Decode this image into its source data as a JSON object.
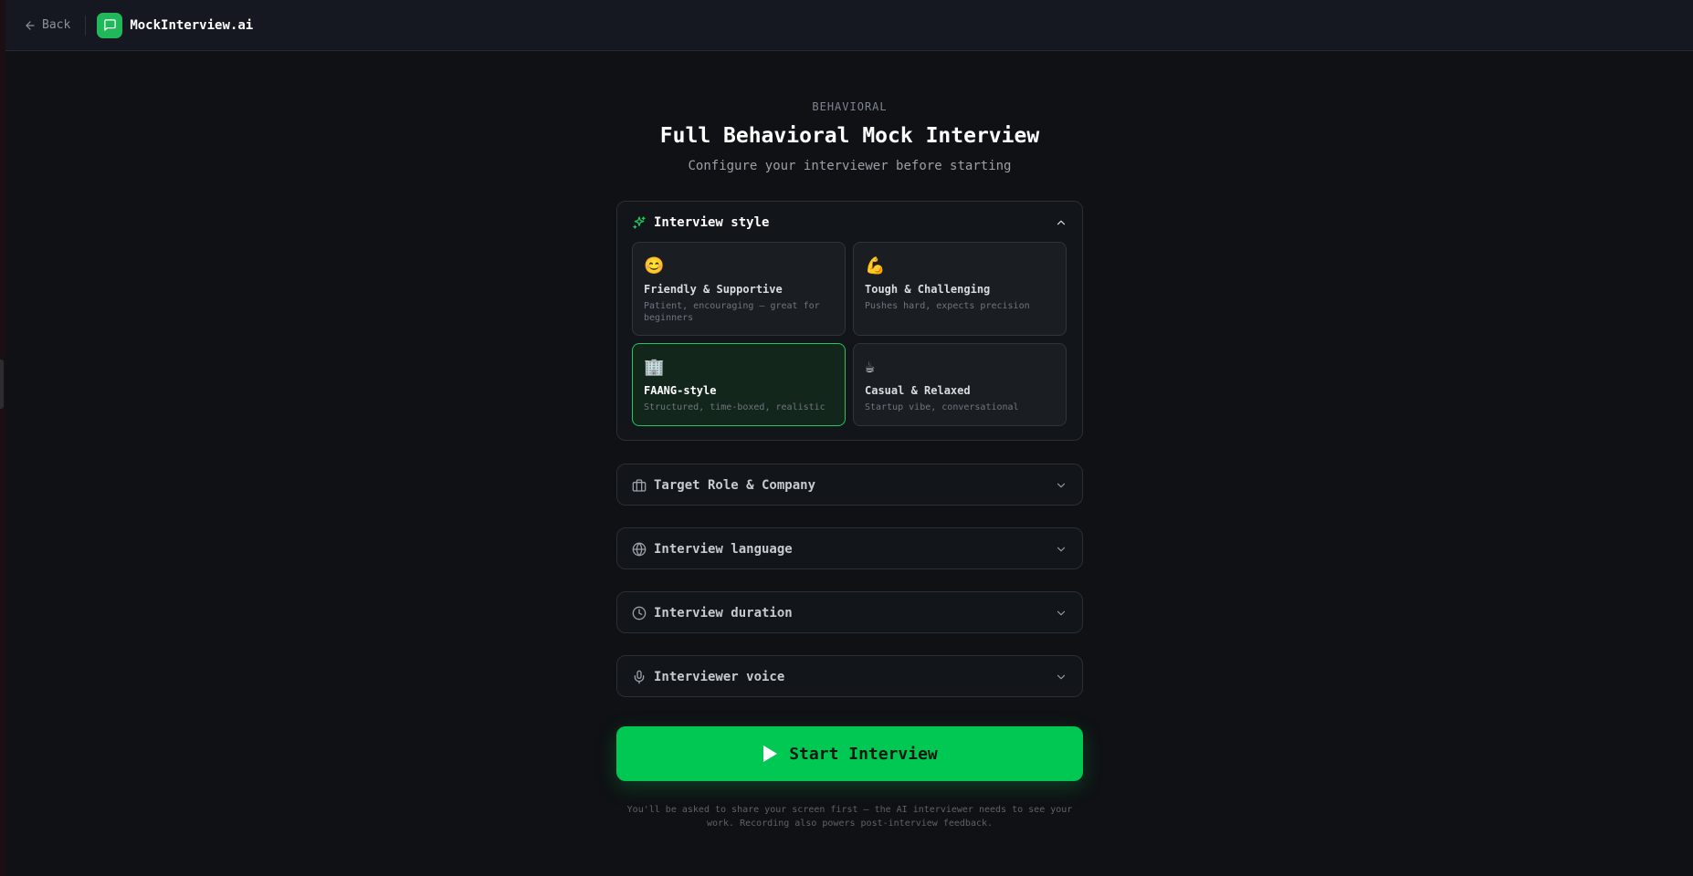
{
  "header": {
    "back_label": "Back",
    "brand": "MockInterview.ai"
  },
  "main": {
    "eyebrow": "BEHAVIORAL",
    "title": "Full Behavioral Mock Interview",
    "subtitle": "Configure your interviewer before starting"
  },
  "style_panel": {
    "title": "Interview style",
    "icon": "sparkles-icon",
    "expanded": true,
    "options": [
      {
        "emoji": "😊",
        "title": "Friendly & Supportive",
        "desc": "Patient, encouraging — great for beginners",
        "selected": false
      },
      {
        "emoji": "💪",
        "title": "Tough & Challenging",
        "desc": "Pushes hard, expects precision",
        "selected": false
      },
      {
        "emoji": "🏢",
        "title": "FAANG-style",
        "desc": "Structured, time-boxed, realistic",
        "selected": true
      },
      {
        "emoji": "☕",
        "title": "Casual & Relaxed",
        "desc": "Startup vibe, conversational",
        "selected": false
      }
    ]
  },
  "sections": [
    {
      "title": "Target Role & Company",
      "icon": "briefcase-icon"
    },
    {
      "title": "Interview language",
      "icon": "globe-icon"
    },
    {
      "title": "Interview duration",
      "icon": "clock-icon"
    },
    {
      "title": "Interviewer voice",
      "icon": "microphone-icon"
    }
  ],
  "start_button": {
    "label": "Start Interview"
  },
  "footer_note": {
    "line1": "You'll be asked to share your screen first — the AI interviewer needs to see your",
    "line2": "work. Recording also powers post-interview feedback."
  },
  "colors": {
    "accent": "#00c853",
    "selected_border": "#22c55e",
    "background": "#0f1114"
  }
}
